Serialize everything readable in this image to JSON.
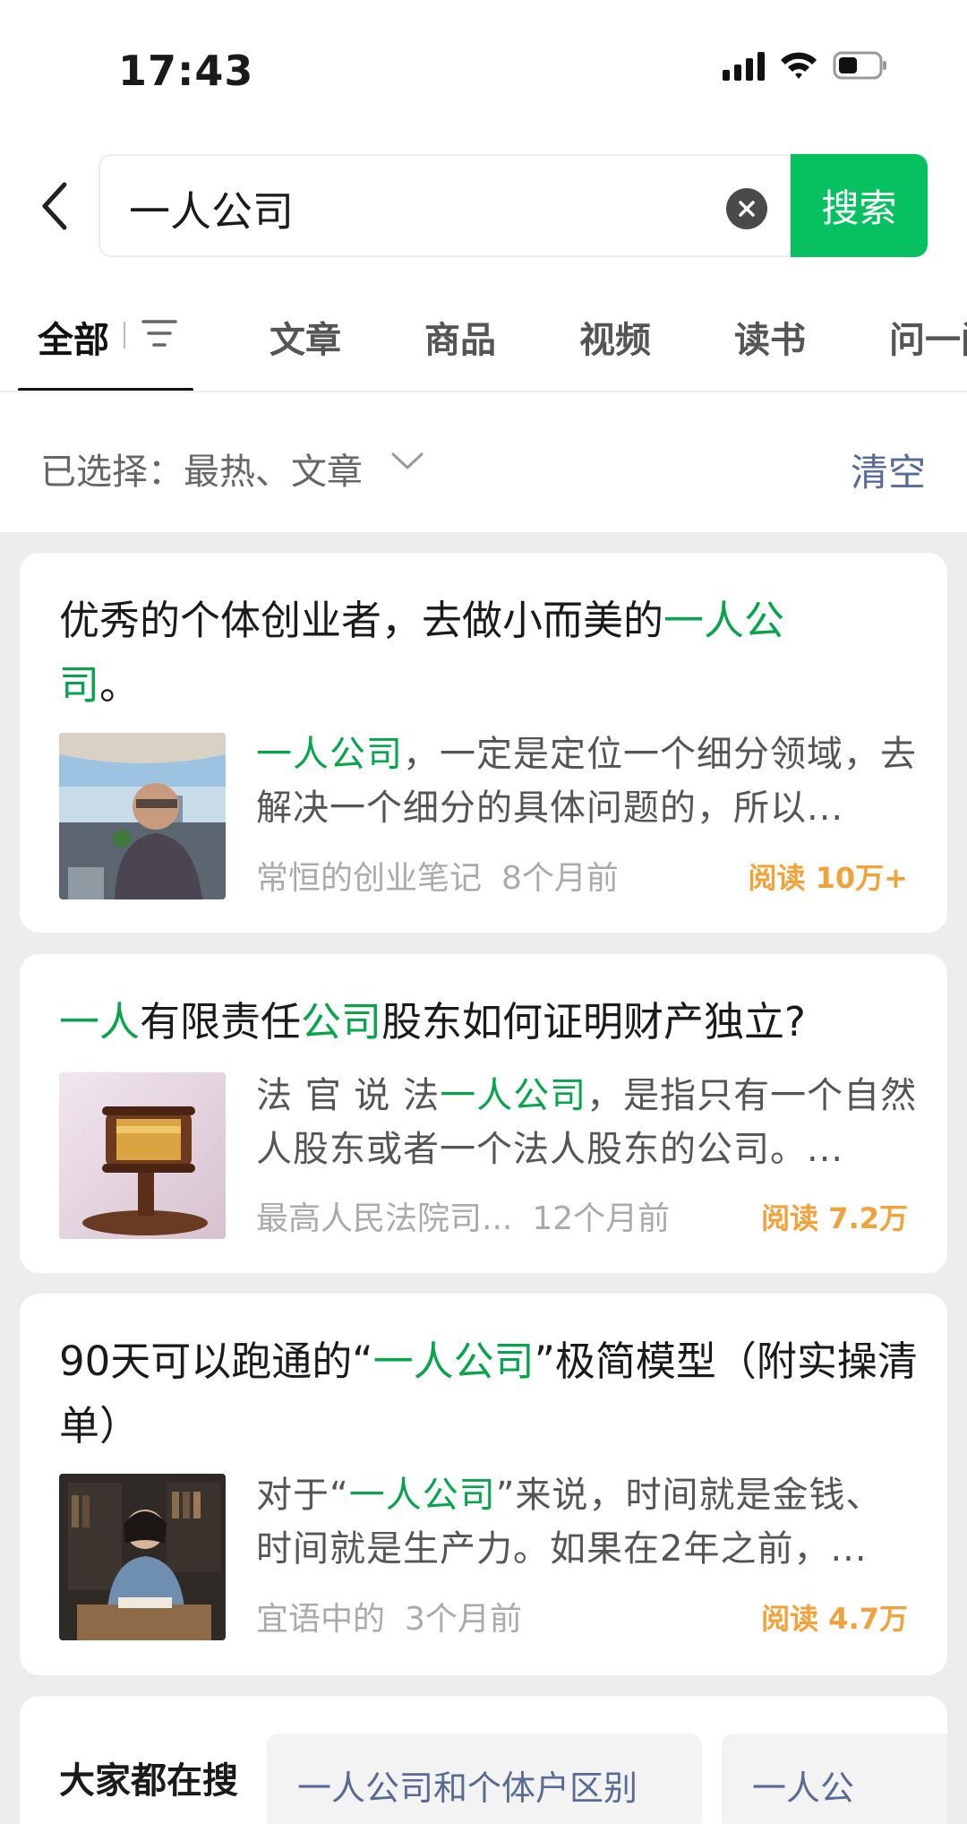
{
  "status": {
    "time": "17:43"
  },
  "search": {
    "query": "一人公司",
    "button_label": "搜索"
  },
  "tabs": [
    {
      "label": "全部"
    },
    {
      "label": "文章"
    },
    {
      "label": "商品"
    },
    {
      "label": "视频"
    },
    {
      "label": "读书"
    },
    {
      "label": "问一问"
    }
  ],
  "filter": {
    "selected_label": "已选择：最热、文章",
    "clear_label": "清空"
  },
  "articles": [
    {
      "title_parts": [
        "优秀的个体创业者，去做小而美的",
        "一人公",
        "司",
        "。"
      ],
      "summary_parts": [
        "一人公司",
        "，一定是定位一个细分领域，去解决一个细分的具体问题的，所以..."
      ],
      "source": "常恒的创业笔记",
      "time": "8个月前",
      "reads": "阅读 10万+"
    },
    {
      "title_parts": [
        "一人",
        "有限责任",
        "公司",
        "股东如何证明财产独立?"
      ],
      "summary_parts": [
        "法 官 说 法",
        "一人公司",
        "，是指只有一个自然人股东或者一个法人股东的公司。..."
      ],
      "source": "最高人民法院司...",
      "time": "12个月前",
      "reads": "阅读 7.2万"
    },
    {
      "title_parts": [
        "90天可以跑通的“",
        "一人公司",
        "”极简模型（附实操清单）"
      ],
      "summary_parts": [
        "对于“",
        "一人公司",
        "”来说，时间就是金钱、时间就是生产力。如果在2年之前，..."
      ],
      "source": "宜语中的",
      "time": "3个月前",
      "reads": "阅读 4.7万"
    }
  ],
  "trending": {
    "label": "大家都在搜",
    "chips": [
      "一人公司和个体户区别",
      "一人公"
    ]
  },
  "colors": {
    "accent": "#07c160",
    "highlight": "#07a44d",
    "link": "#576b95",
    "reads": "#f0a23c"
  }
}
